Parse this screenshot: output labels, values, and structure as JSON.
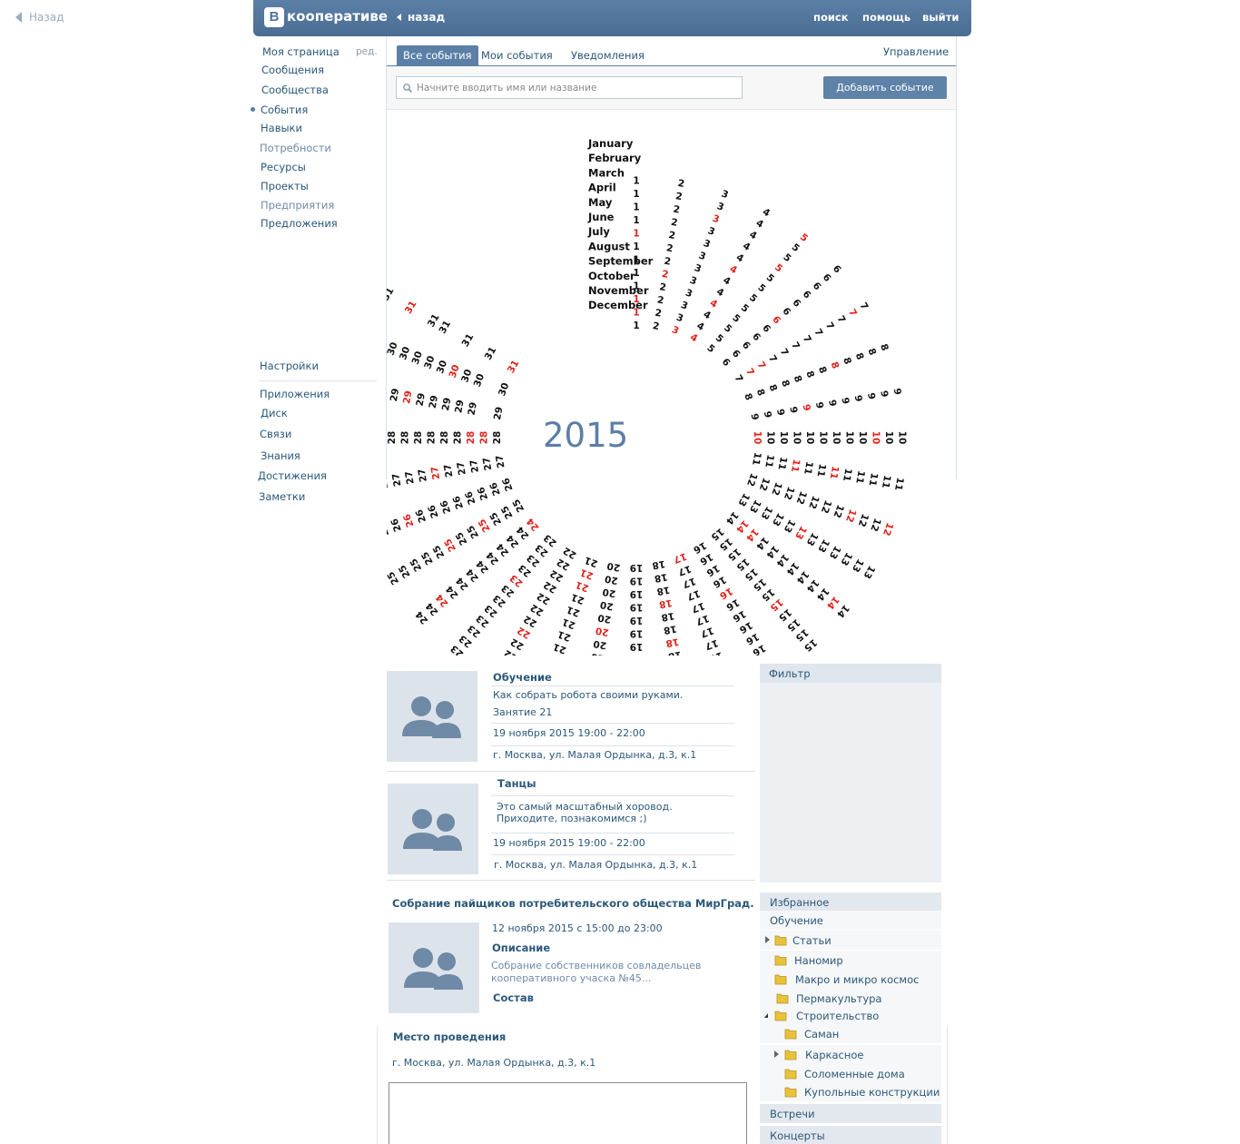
{
  "back": {
    "label": "Назад"
  },
  "header": {
    "logo_letter": "B",
    "logo_text": "кооперативе",
    "back_label": "назад",
    "search": "поиск",
    "help": "помощь",
    "logout": "выйти"
  },
  "nav": {
    "edit": "ред.",
    "items": [
      "Моя страница",
      "Сообщения",
      "Сообщества",
      "События",
      "Навыки",
      "Потребности",
      "Ресурсы",
      "Проекты",
      "Предприятия",
      "Предложения"
    ],
    "bottom": [
      "Настройки",
      "Приложения",
      "Диск",
      "Связи",
      "Знания",
      "Достижения",
      "Заметки"
    ]
  },
  "tabs": [
    "Все события",
    "Мои события",
    "Уведомления"
  ],
  "manage": "Управление",
  "search": {
    "placeholder": "Начните вводить имя или название",
    "add_button": "Добавить событие"
  },
  "calendar": {
    "year": "2015",
    "months": [
      {
        "name": "January",
        "days": 31,
        "start": 4,
        "red": [
          4
        ]
      },
      {
        "name": "February",
        "days": 28,
        "start": 0,
        "red": [
          1
        ]
      },
      {
        "name": "March",
        "days": 31,
        "start": 0,
        "red": [
          1
        ]
      },
      {
        "name": "April",
        "days": 30,
        "start": 3,
        "red": []
      },
      {
        "name": "May",
        "days": 31,
        "start": 5,
        "red": []
      },
      {
        "name": "June",
        "days": 30,
        "start": 1,
        "red": []
      },
      {
        "name": "July",
        "days": 31,
        "start": 3,
        "red": []
      },
      {
        "name": "August",
        "days": 31,
        "start": 6,
        "red": []
      },
      {
        "name": "September",
        "days": 30,
        "start": 2,
        "red": []
      },
      {
        "name": "October",
        "days": 31,
        "start": 4,
        "red": []
      },
      {
        "name": "November",
        "days": 30,
        "start": 0,
        "red": []
      },
      {
        "name": "December",
        "days": 31,
        "start": 2,
        "red": []
      }
    ]
  },
  "events": [
    {
      "title": "Обучение",
      "desc1": "Как собрать робота своими руками.",
      "desc2": "Занятие 21",
      "date": "19 ноября 2015   19:00 - 22:00",
      "place": "г. Москва, ул. Малая Ордынка, д.3, к.1"
    },
    {
      "title": "Танцы",
      "desc1": "Это самый масштабный хоровод.",
      "desc2": "Приходите, познакомимся ;)",
      "date": "19 ноября 2015   19:00 - 22:00",
      "place": "г. Москва, ул. Малая Ордынка, д.3, к.1"
    }
  ],
  "meeting": {
    "title": "Собрание пайщиков потребительского общества  МирГрад.",
    "date": "12 ноября 2015  с 15:00 до 23:00",
    "desc_head": "Описание",
    "desc1": "Собрание собственников совладельцев",
    "desc2": "кооперативного учаска №45...",
    "members": "Состав",
    "venue_head": "Место проведения",
    "venue": "г. Москва, ул. Малая Ордынка, д.3, к.1"
  },
  "filter": {
    "label": "Фильтр",
    "favorites": "Избранное",
    "learning": "Обучение",
    "folders": [
      "Статьи",
      "Наномир",
      "Макро и микро космос",
      "Пермакультура",
      "Строительство",
      "Саман",
      "Каркасное",
      "Соломенные дома",
      "Купольные конструкции"
    ],
    "meetings": "Встречи",
    "concerts": "Концерты"
  }
}
